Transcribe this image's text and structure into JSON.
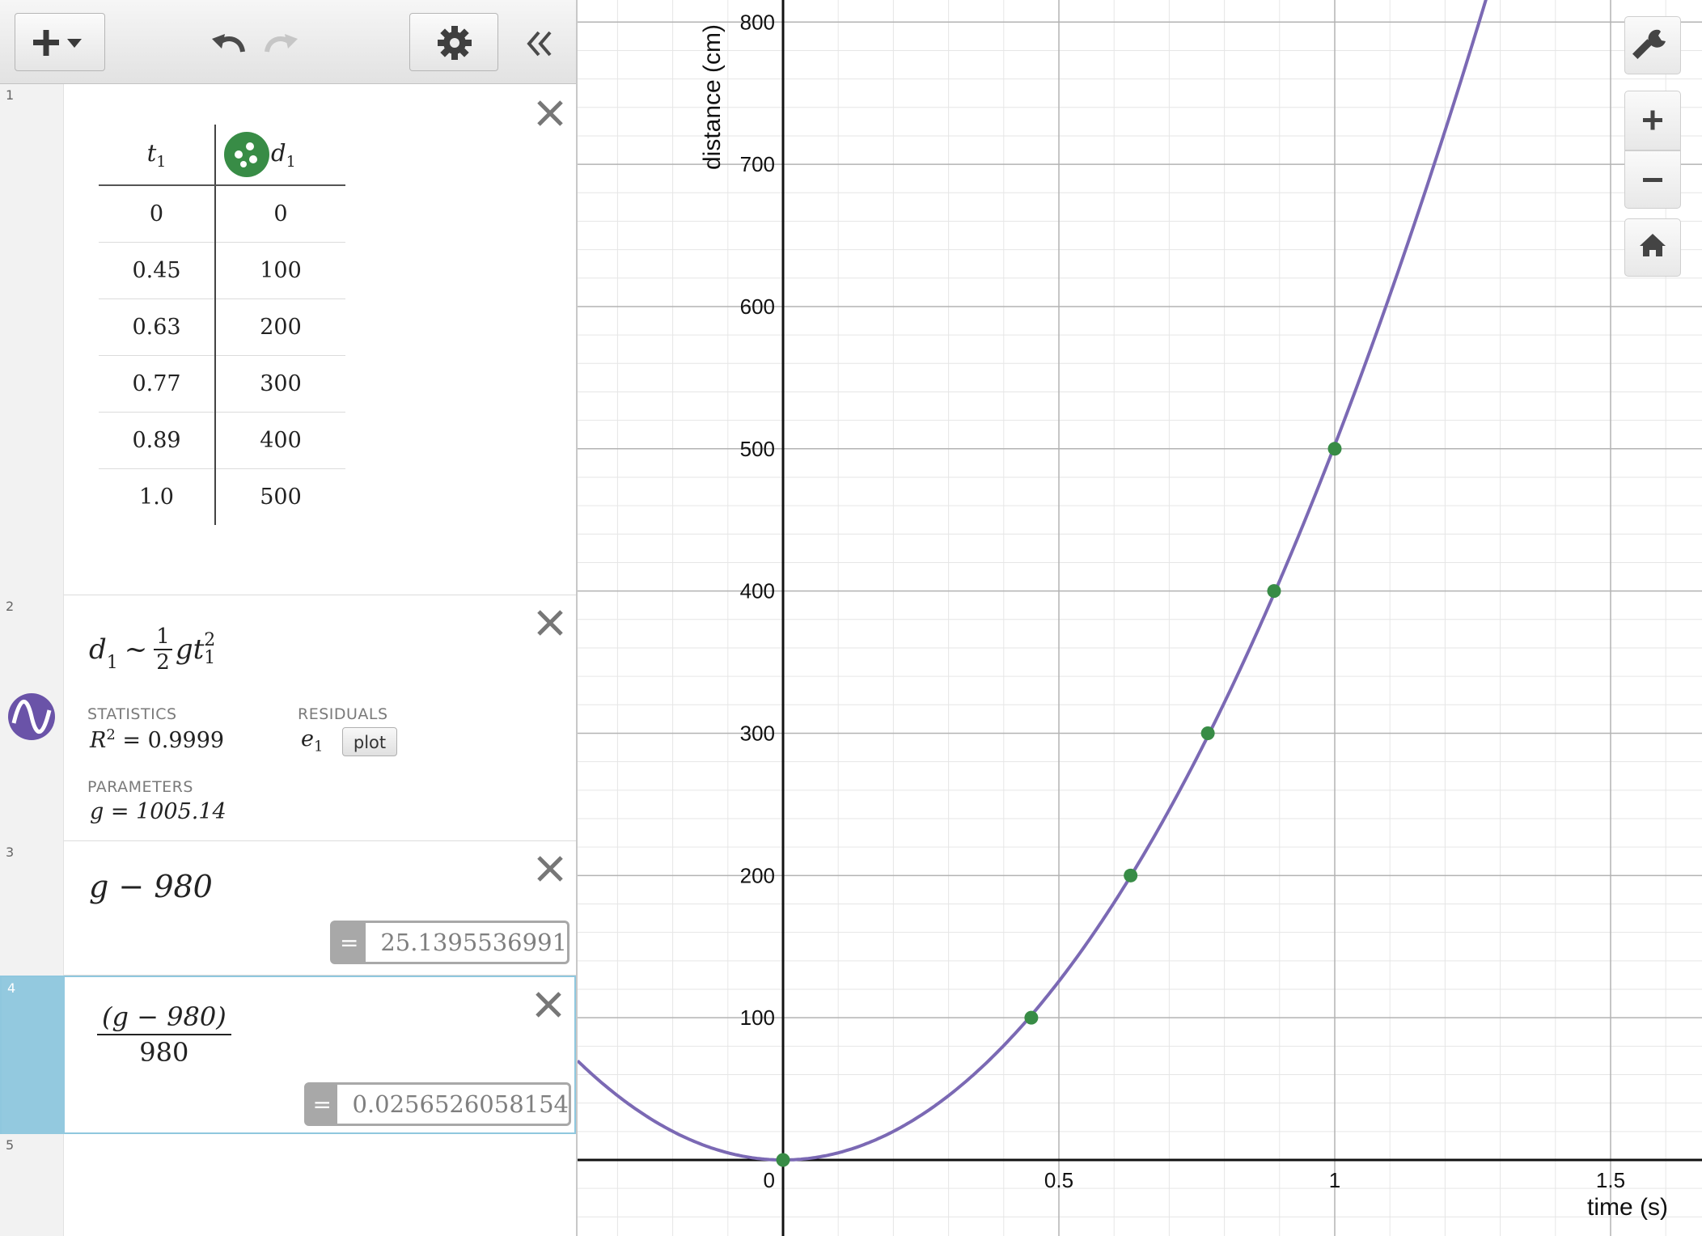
{
  "toolbar": {
    "add_icon": "plus-dropdown-icon",
    "undo_icon": "undo-icon",
    "redo_icon": "redo-icon",
    "settings_icon": "gear-icon",
    "collapse_icon": "double-chevron-left-icon"
  },
  "expressions": [
    {
      "num": "1",
      "type": "table",
      "columns": [
        "t",
        "d"
      ],
      "column_subscripts": [
        "1",
        "1"
      ],
      "rows": [
        [
          "0",
          "0"
        ],
        [
          "0.45",
          "100"
        ],
        [
          "0.63",
          "200"
        ],
        [
          "0.77",
          "300"
        ],
        [
          "0.89",
          "400"
        ],
        [
          "1.0",
          "500"
        ]
      ],
      "point_color": "#388c46"
    },
    {
      "num": "2",
      "type": "regression",
      "lhs": "d",
      "lhs_sub": "1",
      "tilde": "~",
      "frac_num": "1",
      "frac_den": "2",
      "rhs_var": "gt",
      "rhs_sub": "1",
      "rhs_sup": "2",
      "statistics_label": "STATISTICS",
      "r2_lhs": "R",
      "r2_sup": "2",
      "r2_value": "= 0.9999",
      "residuals_label": "RESIDUALS",
      "residual_var": "e",
      "residual_sub": "1",
      "plot_button": "plot",
      "parameters_label": "PARAMETERS",
      "param_value": "g = 1005.14",
      "curve_color": "#7b69b4"
    },
    {
      "num": "3",
      "type": "expression",
      "latex_text": "g − 980",
      "result_eq": "=",
      "result": "25.1395536991"
    },
    {
      "num": "4",
      "type": "expression",
      "numerator": "(g − 980)",
      "denominator": "980",
      "result_eq": "=",
      "result": "0.0256526058154",
      "selected": true
    },
    {
      "num": "5",
      "type": "empty"
    }
  ],
  "graph": {
    "x_label": "time (s)",
    "y_label": "distance (cm)",
    "x_ticks": [
      "0.5",
      "1",
      "1.5"
    ],
    "y_ticks": [
      "100",
      "200",
      "300",
      "400",
      "500",
      "600",
      "700",
      "800"
    ],
    "origin_label": "0",
    "xlim": [
      -0.75,
      3.3
    ],
    "ylim": [
      -52,
      830
    ],
    "grid": true,
    "curve_color": "#7b69b4",
    "point_color": "#388c46",
    "side_buttons": [
      "wrench-icon",
      "zoom-in-icon",
      "zoom-out-icon",
      "home-icon"
    ]
  },
  "chart_data": {
    "type": "scatter",
    "title": "",
    "xlabel": "time (s)",
    "ylabel": "distance (cm)",
    "series": [
      {
        "name": "",
        "type": "scatter",
        "x": [
          0,
          0.45,
          0.63,
          0.77,
          0.89,
          1.0
        ],
        "y": [
          0,
          100,
          200,
          300,
          400,
          500
        ]
      },
      {
        "name": "",
        "type": "line",
        "equation": "d = 0.5 * 1005.14 * t^2",
        "g": 1005.14
      }
    ],
    "xlim": [
      -0.75,
      3.3
    ],
    "ylim": [
      -52,
      830
    ]
  }
}
